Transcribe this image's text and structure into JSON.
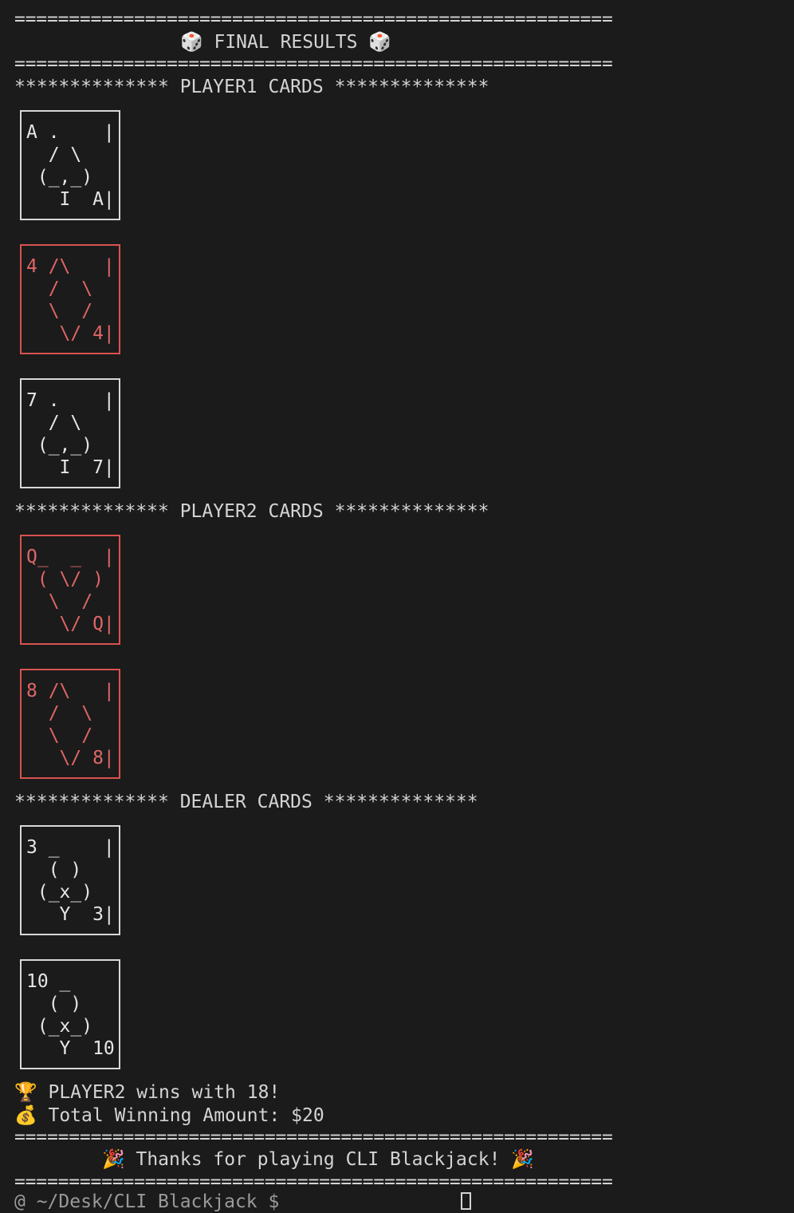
{
  "rule": "=======================================================",
  "header": {
    "title": "🎲 FINAL RESULTS 🎲"
  },
  "sections": {
    "player1": "************** PLAYER1 CARDS **************",
    "player2": "************** PLAYER2 CARDS **************",
    "dealer": "************** DEALER CARDS **************"
  },
  "cards": {
    "p1_c1": {
      "rank": "A",
      "suit": "spades",
      "art": "A .    |\n  / \\   \n (_,_)  \n   I  A|"
    },
    "p1_c2": {
      "rank": "4",
      "suit": "diamonds",
      "art": "4 /\\   |\n  /  \\  \n  \\  /  \n   \\/ 4|"
    },
    "p1_c3": {
      "rank": "7",
      "suit": "spades",
      "art": "7 .    |\n  / \\   \n (_,_)  \n   I  7|"
    },
    "p2_c1": {
      "rank": "Q",
      "suit": "hearts",
      "art": "Q_  _  |\n ( \\/ ) \n  \\  /  \n   \\/ Q|"
    },
    "p2_c2": {
      "rank": "8",
      "suit": "diamonds",
      "art": "8 /\\   |\n  /  \\  \n  \\  /  \n   \\/ 8|"
    },
    "d_c1": {
      "rank": "3",
      "suit": "clubs",
      "art": "3 _    |\n  ( )   \n (_x_)  \n   Y  3|"
    },
    "d_c2": {
      "rank": "10",
      "suit": "clubs",
      "art": "10 _    \n  ( )   \n (_x_)  \n   Y  10"
    }
  },
  "results": {
    "winner": "🏆 PLAYER2 wins with 18!",
    "amount": "💰 Total Winning Amount: $20"
  },
  "footer": {
    "thanks": "🎉 Thanks for playing CLI Blackjack! 🎉"
  },
  "prompt": {
    "text": "@ ~/Desk/CLI Blackjack $ "
  },
  "colors": {
    "background": "#1b1b1b",
    "text": "#d4d4d4",
    "red_suit": "#e06666"
  }
}
